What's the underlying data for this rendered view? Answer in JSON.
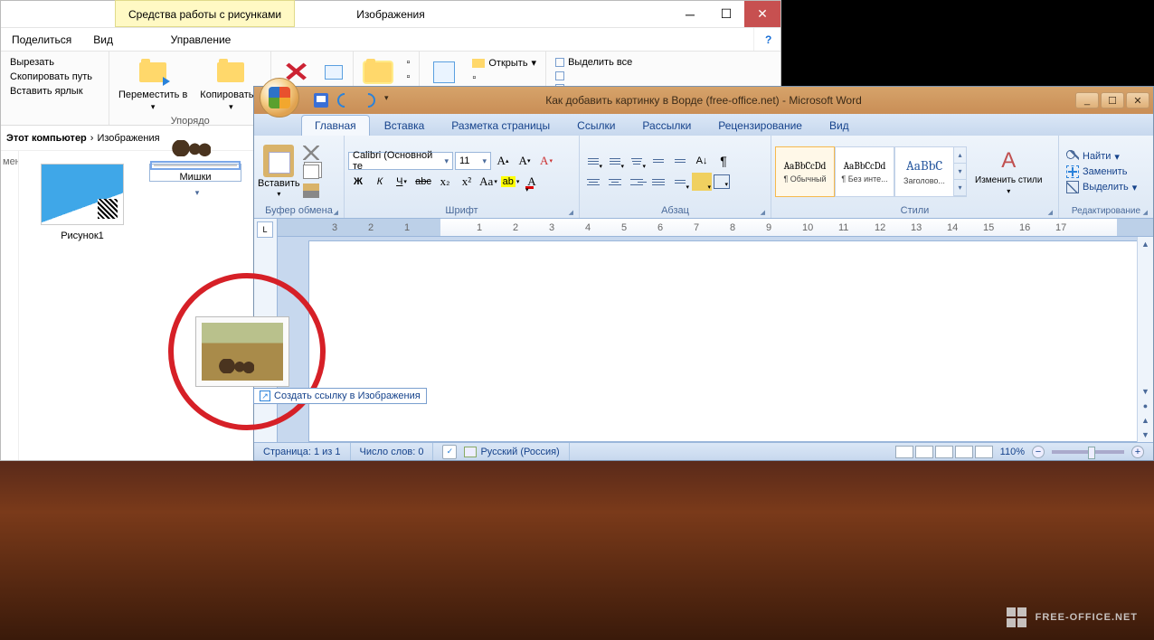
{
  "explorer": {
    "contextual_tab": "Средства работы с рисунками",
    "window_title": "Изображения",
    "tabs": {
      "share": "Поделиться",
      "view": "Вид",
      "manage": "Управление"
    },
    "ribbon": {
      "clipboard": {
        "cut": "Вырезать",
        "copy_path": "Скопировать путь",
        "paste_shortcut": "Вставить ярлык"
      },
      "move": "Переместить в",
      "copy": "Копировать в",
      "organize_label": "Упорядо",
      "delete": "Удалить",
      "rename": "Переименовать",
      "new_folder": "Создать папку",
      "open": "Открыть",
      "select_all": "Выделить все"
    },
    "breadcrumb": {
      "root": "Этот компьютер",
      "folder": "Изображения"
    },
    "side": "мена",
    "files": [
      {
        "name": "Рисунок1"
      },
      {
        "name": "Мишки"
      }
    ],
    "drag_tooltip": "Создать ссылку в Изображения"
  },
  "word": {
    "title": "Как добавить картинку в Ворде (free-office.net) - Microsoft Word",
    "tabs": [
      "Главная",
      "Вставка",
      "Разметка страницы",
      "Ссылки",
      "Рассылки",
      "Рецензирование",
      "Вид"
    ],
    "clipboard": {
      "paste": "Вставить",
      "label": "Буфер обмена"
    },
    "font": {
      "name": "Calibri (Основной те",
      "size": "11",
      "label": "Шрифт"
    },
    "paragraph": {
      "label": "Абзац"
    },
    "styles": {
      "items": [
        {
          "preview": "AaBbCcDd",
          "name": "¶ Обычный"
        },
        {
          "preview": "AaBbCcDd",
          "name": "¶ Без инте..."
        },
        {
          "preview": "AaBbC",
          "name": "Заголово..."
        }
      ],
      "change": "Изменить стили",
      "label": "Стили"
    },
    "editing": {
      "find": "Найти",
      "replace": "Заменить",
      "select": "Выделить",
      "label": "Редактирование"
    },
    "ruler_l": "L",
    "status": {
      "page": "Страница: 1 из 1",
      "words": "Число слов: 0",
      "lang": "Русский (Россия)",
      "zoom": "110%"
    }
  },
  "watermark": "FREE-OFFICE.NET"
}
